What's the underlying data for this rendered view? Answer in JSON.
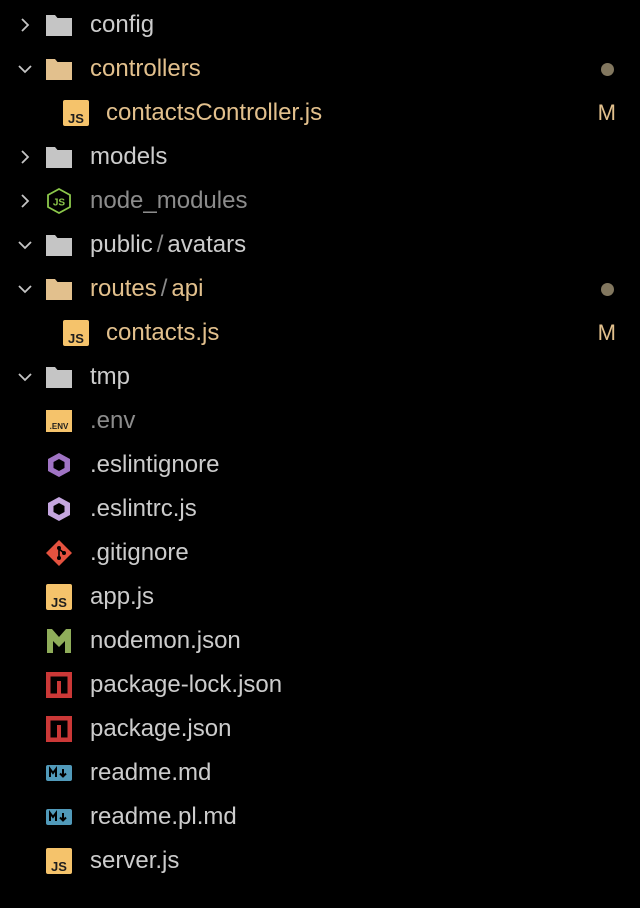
{
  "colors": {
    "background": "#000000",
    "text": "#cccccc",
    "modified": "#e2c08d",
    "ignored": "#8c8c8c",
    "folder_icon": "#c5c5c5",
    "folder_modified_icon": "#e2c08d",
    "js_icon": "#f5c36b",
    "node_icon": "#8cc84b",
    "eslint_icon": "#a074c4",
    "git_icon": "#e4523f",
    "nodemon_icon": "#8fad5a",
    "npm_icon": "#cb3837",
    "markdown_icon": "#519aba",
    "modified_dot": "#82775f"
  },
  "explorer": {
    "items": [
      {
        "label": "config",
        "kind": "folder",
        "expanded": false,
        "icon": "folder-icon"
      },
      {
        "label": "controllers",
        "kind": "folder",
        "expanded": true,
        "icon": "folder-icon",
        "status": "modified-dot"
      },
      {
        "label": "contactsController.js",
        "kind": "file",
        "icon": "js-icon",
        "status": "M"
      },
      {
        "label": "models",
        "kind": "folder",
        "expanded": false,
        "icon": "folder-icon"
      },
      {
        "label": "node_modules",
        "kind": "folder",
        "expanded": false,
        "icon": "nodejs-icon"
      },
      {
        "label": "public",
        "label_suffix": "avatars",
        "kind": "folder",
        "expanded": true,
        "icon": "folder-icon"
      },
      {
        "label": "routes",
        "label_suffix": "api",
        "kind": "folder",
        "expanded": true,
        "icon": "folder-icon",
        "status": "modified-dot"
      },
      {
        "label": "contacts.js",
        "kind": "file",
        "icon": "js-icon",
        "status": "M"
      },
      {
        "label": "tmp",
        "kind": "folder",
        "expanded": true,
        "icon": "folder-icon"
      },
      {
        "label": ".env",
        "kind": "file",
        "icon": "env-icon",
        "env_text": ".ENV"
      },
      {
        "label": ".eslintignore",
        "kind": "file",
        "icon": "eslint-icon"
      },
      {
        "label": ".eslintrc.js",
        "kind": "file",
        "icon": "eslint-icon"
      },
      {
        "label": ".gitignore",
        "kind": "file",
        "icon": "git-icon"
      },
      {
        "label": "app.js",
        "kind": "file",
        "icon": "js-icon"
      },
      {
        "label": "nodemon.json",
        "kind": "file",
        "icon": "nodemon-icon"
      },
      {
        "label": "package-lock.json",
        "kind": "file",
        "icon": "npm-icon"
      },
      {
        "label": "package.json",
        "kind": "file",
        "icon": "npm-icon"
      },
      {
        "label": "readme.md",
        "kind": "file",
        "icon": "markdown-icon"
      },
      {
        "label": "readme.pl.md",
        "kind": "file",
        "icon": "markdown-icon"
      },
      {
        "label": "server.js",
        "kind": "file",
        "icon": "js-icon"
      }
    ],
    "path_separator": "/"
  }
}
